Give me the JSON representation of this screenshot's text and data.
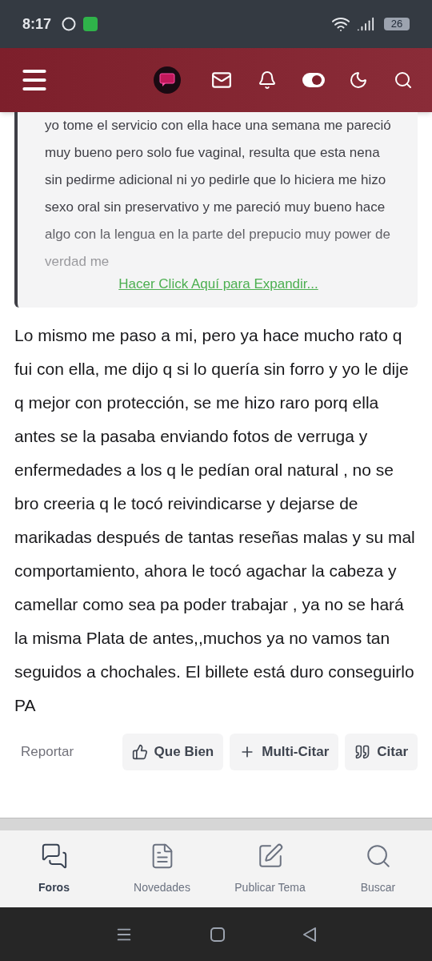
{
  "status_bar": {
    "time": "8:17",
    "battery": "26"
  },
  "quote": {
    "text": "yo tome el servicio con ella hace una semana me pareció muy bueno pero solo fue vaginal, resulta que esta nena sin pedirme adicional ni yo pedirle que lo hiciera me hizo sexo oral sin preservativo y me pareció muy bueno hace algo con la lengua en la parte del prepucio muy power de verdad me",
    "expand_link": "Hacer Click Aquí para Expandir..."
  },
  "post": {
    "text": "Lo mismo me paso a mi, pero ya hace mucho rato q fui con ella, me dijo q si lo quería sin forro y yo le dije q mejor con protección, se me hizo raro porq ella antes se la pasaba enviando fotos de verruga y enfermedades a los q le pedían oral natural , no se bro creeria q le tocó reivindicarse y dejarse de marikadas después de tantas reseñas malas y su mal comportamiento, ahora le tocó agachar la cabeza y camellar como sea pa poder trabajar , ya no se hará la misma Plata de antes,,muchos ya no vamos tan seguidos a chochales. El billete está duro conseguirlo PA"
  },
  "report_link": "Reportar",
  "actions": [
    {
      "kind": "like",
      "label": "Que Bien"
    },
    {
      "kind": "multiquote",
      "label": "Multi-Citar"
    },
    {
      "kind": "quote",
      "label": "Citar"
    }
  ],
  "bottom_nav": [
    {
      "kind": "forums",
      "label": "Foros",
      "selected": true
    },
    {
      "kind": "news",
      "label": "Novedades",
      "selected": false
    },
    {
      "kind": "post",
      "label": "Publicar Tema",
      "selected": false
    },
    {
      "kind": "search",
      "label": "Buscar",
      "selected": false
    }
  ]
}
